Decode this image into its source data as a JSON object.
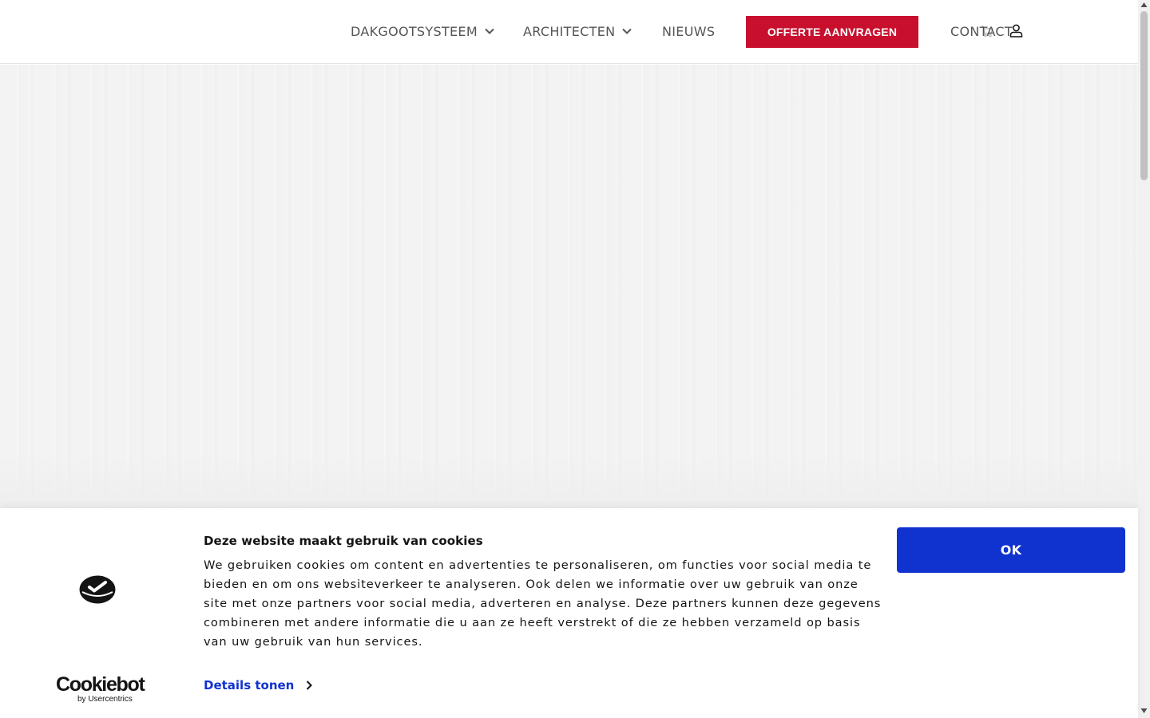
{
  "nav": {
    "items": [
      {
        "label": "DAKGOOTSYSTEEM",
        "has_dropdown": true
      },
      {
        "label": "ARCHITECTEN",
        "has_dropdown": true
      },
      {
        "label": "NIEUWS",
        "has_dropdown": false
      }
    ],
    "cta_label": "OFFERTE AANVRAGEN",
    "contact_label": "CONTACT",
    "icons": [
      "chevron-down-icon",
      "cart-icon",
      "user-icon"
    ]
  },
  "cookie_banner": {
    "title": "Deze website maakt gebruik van cookies",
    "text": "We gebruiken cookies om content en advertenties te personaliseren, om functies voor social media te bieden en om ons websiteverkeer te analyseren. Ook delen we informatie over uw gebruik van onze site met onze partners voor social media, adverteren en analyse. Deze partners kunnen deze gegevens combineren met andere informatie die u aan ze heeft verstrekt of die ze hebben verzameld op basis van uw gebruik van hun services.",
    "details_label": "Details tonen",
    "ok_label": "OK",
    "brand_name": "Cookiebot",
    "brand_sub": "by Usercentrics"
  },
  "colors": {
    "cta_red": "#c8102e",
    "cookie_blue": "#1032cf",
    "text_dark": "#141414"
  }
}
